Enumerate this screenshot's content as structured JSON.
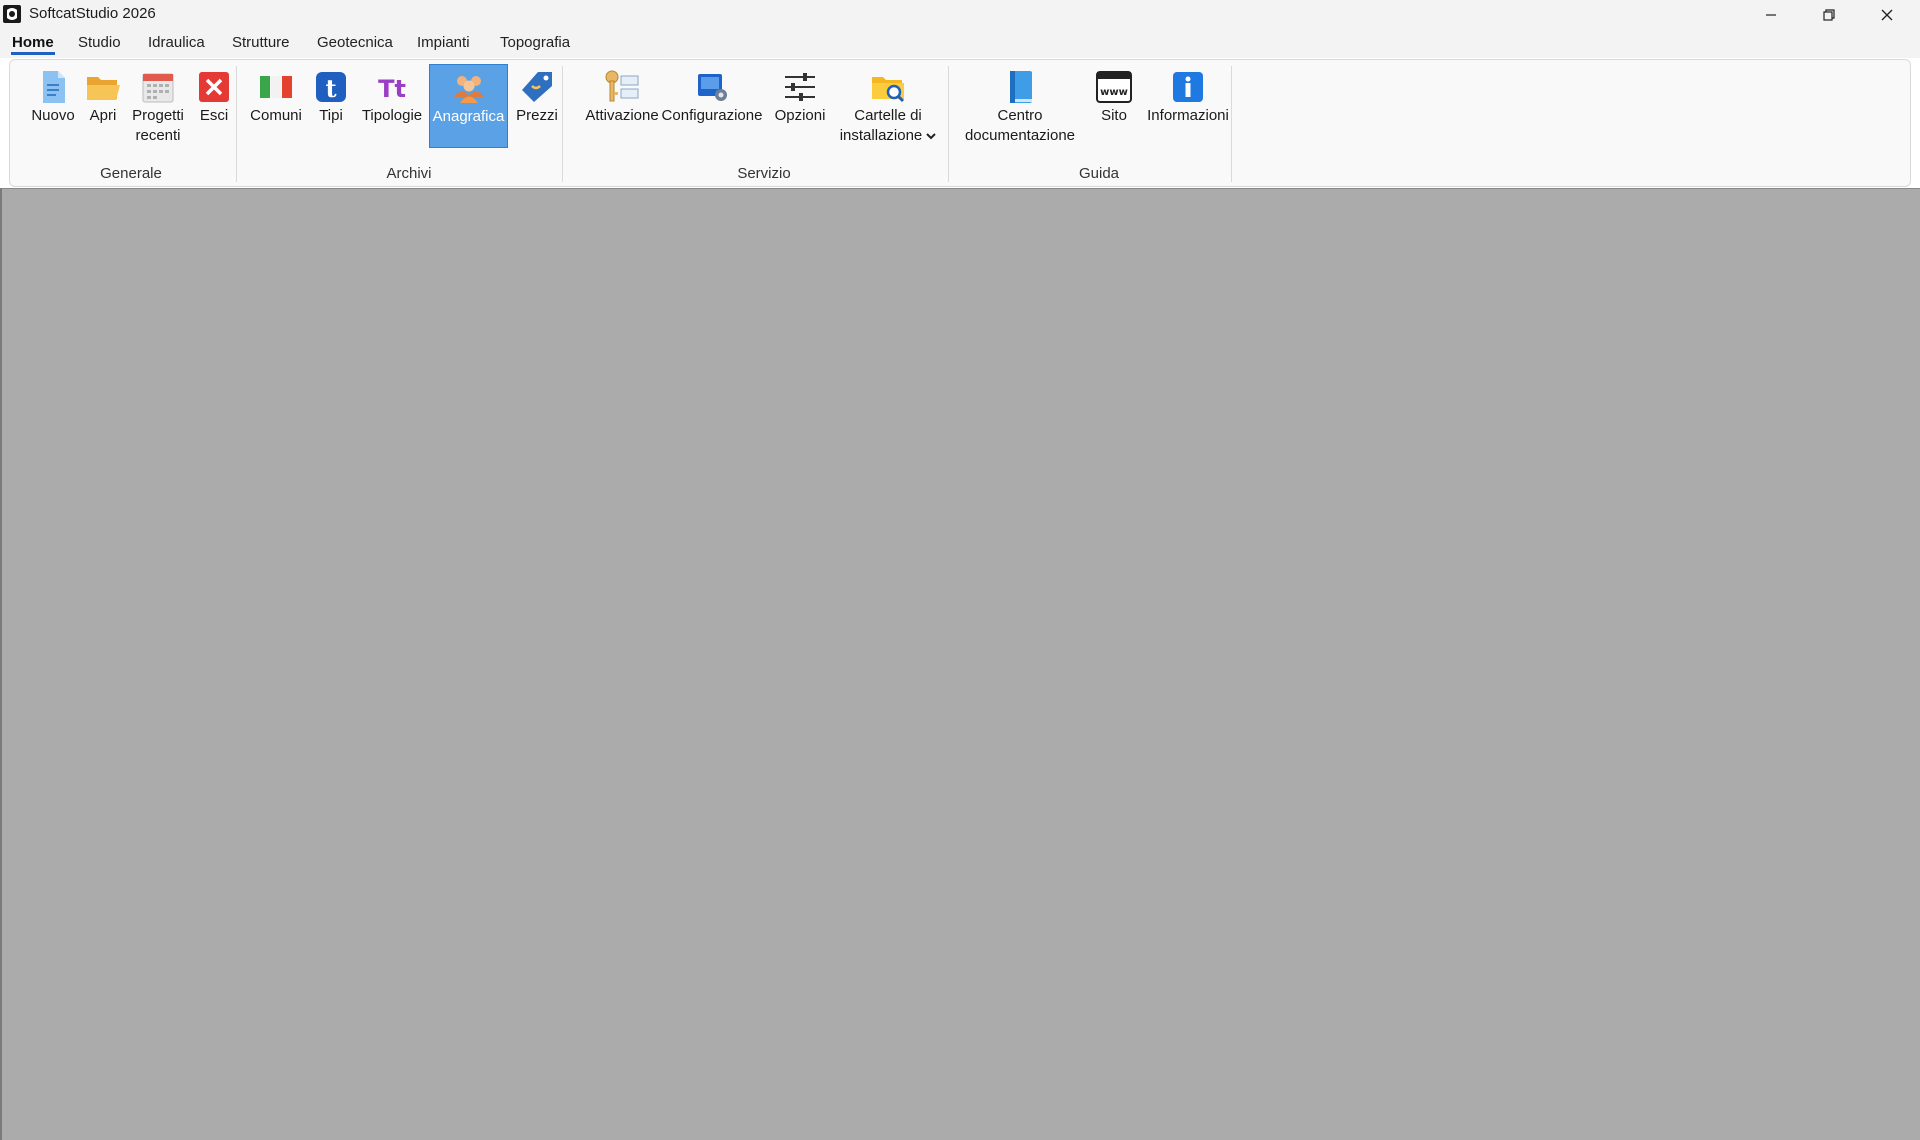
{
  "window": {
    "title": "SoftcatStudio 2026"
  },
  "tabs": [
    {
      "label": "Home"
    },
    {
      "label": "Studio"
    },
    {
      "label": "Idraulica"
    },
    {
      "label": "Strutture"
    },
    {
      "label": "Geotecnica"
    },
    {
      "label": "Impianti"
    },
    {
      "label": "Topografia"
    }
  ],
  "ribbon": {
    "groups": {
      "generale": "Generale",
      "archivi": "Archivi",
      "servizio": "Servizio",
      "guida": "Guida"
    },
    "buttons": {
      "nuovo": {
        "label": "Nuovo",
        "icon": "new-document-icon"
      },
      "apri": {
        "label": "Apri",
        "icon": "open-folder-icon"
      },
      "progetti_recenti": {
        "label1": "Progetti",
        "label2": "recenti",
        "icon": "calendar-icon"
      },
      "esci": {
        "label": "Esci",
        "icon": "exit-icon"
      },
      "comuni": {
        "label": "Comuni",
        "icon": "italian-flag-icon"
      },
      "tipi": {
        "label": "Tipi",
        "icon": "t-letter-icon"
      },
      "tipologie": {
        "label": "Tipologie",
        "icon": "tt-letters-icon"
      },
      "anagrafica": {
        "label": "Anagrafica",
        "icon": "people-icon",
        "selected": true
      },
      "prezzi": {
        "label": "Prezzi",
        "icon": "price-tag-icon"
      },
      "attivazione": {
        "label": "Attivazione",
        "icon": "key-icon"
      },
      "configurazione": {
        "label": "Configurazione",
        "icon": "configuration-icon"
      },
      "opzioni": {
        "label": "Opzioni",
        "icon": "sliders-icon"
      },
      "cartelle": {
        "label1": "Cartelle di",
        "label2": "installazione",
        "icon": "folder-search-icon",
        "dropdown": true
      },
      "centro": {
        "label1": "Centro",
        "label2": "documentazione",
        "icon": "book-icon"
      },
      "sito": {
        "label": "Sito",
        "icon": "www-icon"
      },
      "informazioni": {
        "label": "Informazioni",
        "icon": "info-icon"
      }
    }
  },
  "colors": {
    "accent": "#1f5fbf",
    "selected_bg": "#5aa1e6",
    "workspace": "#ababab"
  }
}
